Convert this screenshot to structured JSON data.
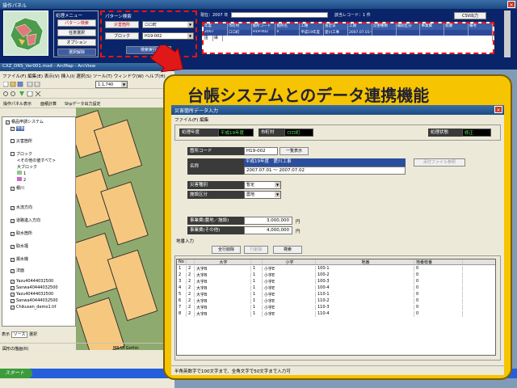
{
  "op_panel": {
    "title": "操作パネル",
    "close": "×",
    "menu_title": "処理メニュー",
    "menu_buttons": [
      "パターン検索",
      "任意選択",
      "オプション",
      "選択解除"
    ],
    "pattern_title": "パターン検索",
    "pattern_labels": [
      "災害箇所",
      "ブロック"
    ],
    "pattern_values": [
      "ロロ町",
      "H19-002"
    ],
    "search_button": "検索実行",
    "year_label": "現在：2007 年",
    "record_label": "該当レコード：1 件",
    "csv_button": "CSV出力",
    "table_headers": [
      "年度",
      "市町村",
      "箇所コード",
      "箇所名",
      "工種",
      "査定日",
      "工期",
      "災害種類",
      "補助区分",
      "事業費",
      "経費",
      "備考"
    ],
    "table_row": [
      "2007",
      "ロロ町",
      "H19-002",
      "0",
      "平成19年度",
      "愛川工事",
      "2007.07.01～2007.07.02",
      "",
      "",
      "",
      "",
      ""
    ],
    "table_row2": [
      "田",
      "細"
    ]
  },
  "arcmap": {
    "title": "CXZ_DRS_Ver001.mxd - ArcMap - ArcView",
    "menu": [
      "ファイル(F)",
      "編集(E)",
      "表示(V)",
      "挿入(I)",
      "選択(S)",
      "ツール(T)",
      "ウィンドウ(W)",
      "ヘルプ(H)"
    ],
    "scale": "1:1,740",
    "toolbar_tabs": [
      "操作パネル表示",
      "面積計算",
      "Shpデータ出力設定"
    ],
    "toc": [
      {
        "label": "積品申請システム",
        "checked": true
      },
      {
        "label": "地番",
        "checked": true
      },
      {
        "label": "災害箇所",
        "checked": false
      },
      {
        "label": "ブロック",
        "checked": false
      },
      {
        "label": "<その他の値すべて>",
        "checked": false
      },
      {
        "label": "大ブロック",
        "checked": false
      },
      {
        "label": "1",
        "checked": false
      },
      {
        "label": "2",
        "checked": false
      },
      {
        "label": "積川",
        "checked": true
      },
      {
        "label": "水流方向",
        "checked": true
      },
      {
        "label": "道路進入方向",
        "checked": true
      },
      {
        "label": "取水箇所",
        "checked": true
      },
      {
        "label": "取水堰",
        "checked": true
      },
      {
        "label": "揚水機",
        "checked": true
      },
      {
        "label": "法面",
        "checked": true
      },
      {
        "label": "Yazu40444032500",
        "checked": true
      },
      {
        "label": "Sanwa40444032500",
        "checked": true
      },
      {
        "label": "Yazu40444032500",
        "checked": true
      },
      {
        "label": "Sanwa40444032500",
        "checked": true
      },
      {
        "label": "Chikusen_demo1.tif",
        "checked": true
      }
    ],
    "toc_tabs": [
      "表示",
      "ソース",
      "選択"
    ],
    "draw_label": "図形の描画(R)",
    "font_label": "MS UI Gothic",
    "start": "スタート"
  },
  "callout": {
    "heading": "台帳システムとのデータ連携機能"
  },
  "dialog": {
    "title": "災害箇所データ入力",
    "menu": [
      "ファイル(F)",
      "編集"
    ],
    "fiscal_label": "処理年度",
    "fiscal_value": "平成19年度",
    "city_label": "市町村",
    "city_value": "ロロ町",
    "status_label": "処理状態",
    "status_value": "修正",
    "code_label": "箇所コード",
    "code_value": "H19-002",
    "list_button": "一覧表示",
    "name_label": "名称",
    "name_value": "平成19年度　愛川工事",
    "period_value": "2007.07.01 ～ 2007.07.02",
    "attach_button": "添付ファイル参照",
    "disaster_label": "災害種別",
    "disaster_value": "暫定",
    "subsidy_label": "施設区分",
    "subsidy_value": "農地",
    "cost1_label": "事業費(農地／施設)",
    "cost1_value": "3,000,000",
    "cost1_unit": "円",
    "cost2_label": "事業費(その他)",
    "cost2_value": "4,000,000",
    "cost2_unit": "円",
    "parcel_title": "地番入力",
    "parcel_buttons": [
      "全行削除",
      "行削除",
      "検索"
    ],
    "parcel_headers": [
      "No",
      "大字",
      "",
      "小字",
      "",
      "地番",
      "地番枝番"
    ],
    "parcel_rows": [
      [
        "1",
        "2",
        "大字B",
        "1",
        "小字E",
        "100-1",
        "0"
      ],
      [
        "2",
        "2",
        "大字B",
        "1",
        "小字E",
        "100-2",
        "0"
      ],
      [
        "3",
        "2",
        "大字B",
        "1",
        "小字E",
        "100-3",
        "0"
      ],
      [
        "4",
        "2",
        "大字B",
        "1",
        "小字E",
        "100-4",
        "0"
      ],
      [
        "5",
        "2",
        "大字B",
        "1",
        "小字E",
        "110-1",
        "0"
      ],
      [
        "6",
        "2",
        "大字B",
        "1",
        "小字E",
        "110-2",
        "0"
      ],
      [
        "7",
        "2",
        "大字B",
        "1",
        "小字E",
        "110-3",
        "0"
      ],
      [
        "8",
        "2",
        "大字B",
        "1",
        "小字E",
        "110-4",
        "0"
      ]
    ],
    "status_bar": "半角英数字で100文字まで、全角文字で50文字まで入力可"
  }
}
